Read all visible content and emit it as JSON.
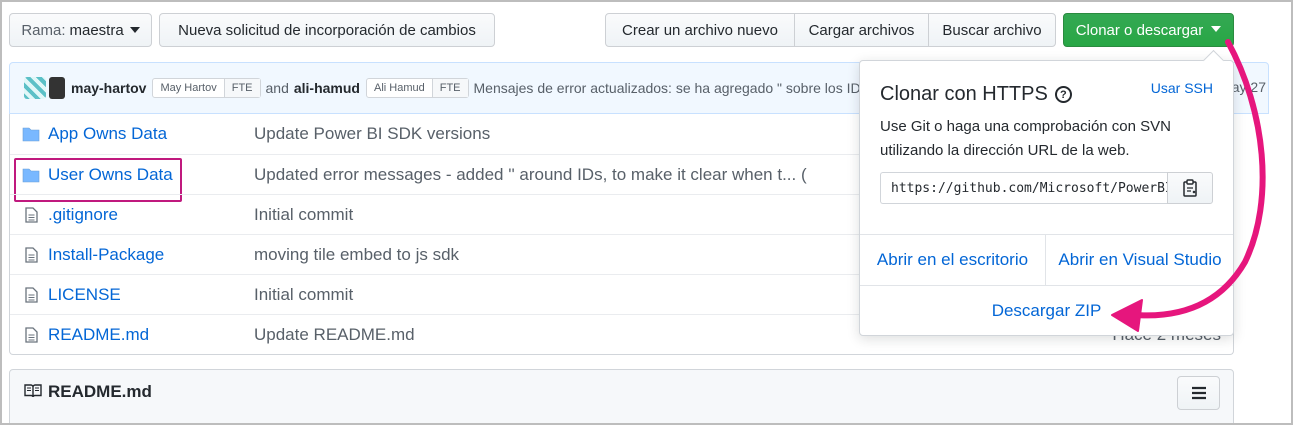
{
  "toolbar": {
    "branch_prefix": "Rama:",
    "branch_name": "maestra",
    "new_pr": "Nueva solicitud de incorporación de cambios",
    "create_file": "Crear un archivo nuevo",
    "upload_files": "Cargar archivos",
    "find_file": "Buscar archivo",
    "clone_download": "Clonar o descargar"
  },
  "commit": {
    "author1": "may-hartov",
    "author1_tag": "May Hartov",
    "fte1": "FTE",
    "and": "and",
    "author2": "ali-hamud",
    "author2_tag": "Ali Hamud",
    "fte2": "FTE",
    "message": "Mensajes de error actualizados: se ha agregado \" sobre los ID...",
    "date_fragment": "ay 27"
  },
  "files": [
    {
      "icon": "folder-icon",
      "name": "App Owns Data",
      "message": "Update Power BI SDK versions",
      "age": ""
    },
    {
      "icon": "folder-icon",
      "name": "User Owns Data",
      "message": "Updated error messages - added '' around IDs, to make it clear when t... (",
      "age": ""
    },
    {
      "icon": "file-icon",
      "name": ".gitignore",
      "message": "Initial commit",
      "age": ""
    },
    {
      "icon": "file-icon",
      "name": "Install-Package",
      "message": "moving tile embed to js sdk",
      "age": ""
    },
    {
      "icon": "file-icon",
      "name": "LICENSE",
      "message": "Initial commit",
      "age": ""
    },
    {
      "icon": "file-icon",
      "name": "README.md",
      "message": "Update README.md",
      "age": "Hace 2 meses"
    }
  ],
  "readme": {
    "title": "README.md",
    "icon": "book-icon",
    "menu_icon": "hamburger-icon"
  },
  "clone_popover": {
    "title": "Clonar con HTTPS",
    "help_icon": "?",
    "use_ssh": "Usar SSH",
    "description": "Use Git o haga una comprobación con SVN utilizando la dirección URL de la web.",
    "url": "https://github.com/Microsoft/PowerBI-Developer-Samples.git",
    "copy_icon": "clipboard-icon",
    "open_desktop": "Abrir en el escritorio",
    "open_vs": "Abrir en Visual Studio",
    "download_zip": "Descargar ZIP"
  },
  "colors": {
    "link": "#0366d6",
    "clone_green": "#28a745",
    "annotation_magenta": "#e6167d",
    "commit_bar_bg": "#f1f8ff"
  }
}
